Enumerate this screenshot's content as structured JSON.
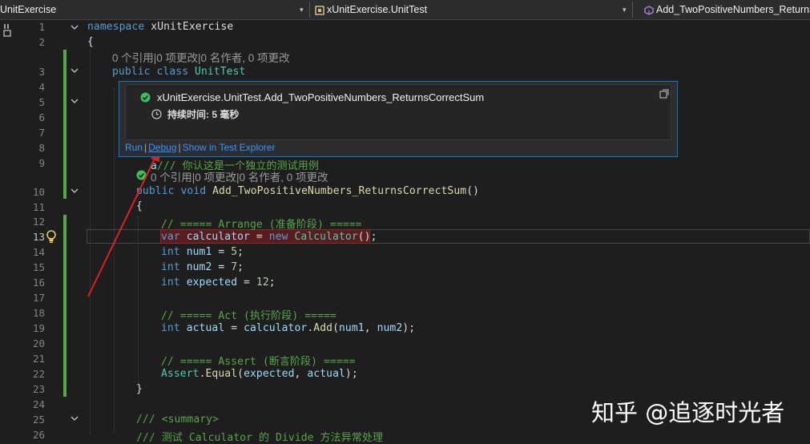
{
  "nav": {
    "project": "UnitExercise",
    "class": "xUnitExercise.UnitTest",
    "member": "Add_TwoPositiveNumbers_ReturnsCorrectSum"
  },
  "lines": [
    "1",
    "2",
    "3",
    "4",
    "5",
    "6",
    "7",
    "8",
    "9",
    "10",
    "11",
    "12",
    "13",
    "14",
    "15",
    "16",
    "17",
    "18",
    "19",
    "20",
    "21",
    "22",
    "23",
    "24",
    "25",
    "26"
  ],
  "code": {
    "l1_kw": "namespace",
    "l1_id": " xUnitExercise",
    "l2": "{",
    "lens1": "0 个引用|0 项更改|0 名作者, 0 项更改",
    "l3_kw": "public class",
    "l3_ty": " UnitTest",
    "l9_frag_a": "a",
    "l9_cm": "/// 你认这是一个独立的测试用例",
    "lens2": "0 个引用|0 项更改|0 名作者, 0 项更改",
    "l10_kw": "public void",
    "l10_fn": " Add_TwoPositiveNumbers_ReturnsCorrectSum",
    "l10_rest": "()",
    "l11": "{",
    "l12": "// ===== Arrange (准备阶段) =====",
    "l13_kw": "var",
    "l13_id": " calculator",
    "l13_eq": " = ",
    "l13_new": "new",
    "l13_ty": " Calculator",
    "l13_end": "();",
    "l14_kw": "int",
    "l14_id": " num1",
    "l14_eq": " = ",
    "l14_num": "5",
    "l14_end": ";",
    "l15_kw": "int",
    "l15_id": " num2",
    "l15_eq": " = ",
    "l15_num": "7",
    "l15_end": ";",
    "l16_kw": "int",
    "l16_id": " expected",
    "l16_eq": " = ",
    "l16_num": "12",
    "l16_end": ";",
    "l18": "// ===== Act (执行阶段) =====",
    "l19_kw": "int",
    "l19_id": " actual",
    "l19_eq": " = ",
    "l19_obj": "calculator",
    "l19_dot": ".",
    "l19_fn": "Add",
    "l19_args_a": "(",
    "l19_a1": "num1",
    "l19_comma": ", ",
    "l19_a2": "num2",
    "l19_end": ");",
    "l21": "// ===== Assert (断言阶段) =====",
    "l22_ty": "Assert",
    "l22_dot": ".",
    "l22_fn": "Equal",
    "l22_a": "(",
    "l22_a1": "expected",
    "l22_comma": ", ",
    "l22_a2": "actual",
    "l22_end": ");",
    "l23": "}",
    "l25": "/// <summary>",
    "l26": "/// 测试 Calculator 的 Divide 方法异常处理"
  },
  "popup": {
    "title": "xUnitExercise.UnitTest.Add_TwoPositiveNumbers_ReturnsCorrectSum",
    "duration": "持续时间: 5 毫秒",
    "run": "Run",
    "debug": "Debug",
    "show": "Show in Test Explorer"
  },
  "watermark": "知乎 @追逐时光者",
  "colors": {
    "accent": "#007acc",
    "pass": "#3ac15a",
    "link": "#3794ff",
    "arrow": "#e02020"
  }
}
